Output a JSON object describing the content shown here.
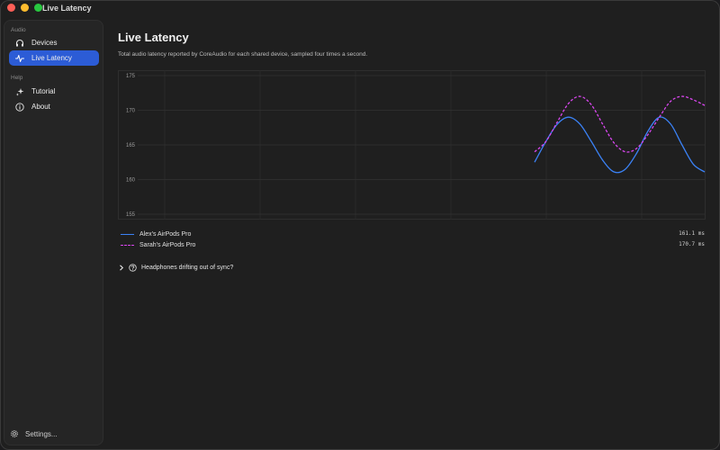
{
  "window": {
    "title": "Live Latency"
  },
  "sidebar": {
    "sections": [
      {
        "label": "Audio"
      },
      {
        "label": "Help"
      }
    ],
    "items": [
      {
        "label": "Devices",
        "icon": "headphones-icon"
      },
      {
        "label": "Live Latency",
        "icon": "waveform-icon"
      },
      {
        "label": "Tutorial",
        "icon": "sparkles-icon"
      },
      {
        "label": "About",
        "icon": "info-icon"
      }
    ],
    "settings_label": "Settings..."
  },
  "main": {
    "title": "Live Latency",
    "subtitle": "Total audio latency reported by CoreAudio for each shared device, sampled four times a second.",
    "disclosure_label": "Headphones drifting out of sync?"
  },
  "legend": [
    {
      "name": "Alex's AirPods Pro",
      "value": "161.1 ms",
      "color": "#3b82f6",
      "dash": "solid"
    },
    {
      "name": "Sarah's AirPods Pro",
      "value": "170.7 ms",
      "color": "#d946ef",
      "dash": "dashed"
    }
  ],
  "chart_data": {
    "type": "line",
    "title": "",
    "xlabel": "",
    "ylabel": "",
    "ylim": [
      155,
      175
    ],
    "xlim": [
      0,
      100
    ],
    "y_ticks": [
      155,
      160,
      165,
      170,
      175
    ],
    "grid": true,
    "series": [
      {
        "name": "Alex's AirPods Pro",
        "color": "#3b82f6",
        "dash": "solid",
        "x": [
          70,
          72,
          74,
          76,
          78,
          80,
          82,
          84,
          86,
          88,
          90,
          92,
          94,
          96,
          98,
          100
        ],
        "values": [
          162.5,
          165.5,
          168.0,
          169.0,
          168.0,
          165.5,
          162.8,
          161.1,
          161.5,
          163.8,
          167.0,
          169.0,
          168.0,
          165.0,
          162.2,
          161.1
        ]
      },
      {
        "name": "Sarah's AirPods Pro",
        "color": "#d946ef",
        "dash": "dashed",
        "x": [
          70,
          72,
          74,
          76,
          78,
          80,
          82,
          84,
          86,
          88,
          90,
          92,
          94,
          96,
          98,
          100
        ],
        "values": [
          164.0,
          165.5,
          168.3,
          171.0,
          172.0,
          170.8,
          168.0,
          165.3,
          164.0,
          164.5,
          166.5,
          169.0,
          171.3,
          172.0,
          171.5,
          170.7
        ]
      }
    ]
  }
}
